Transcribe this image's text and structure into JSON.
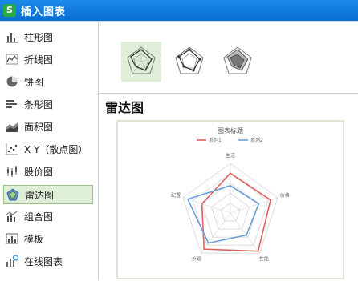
{
  "window": {
    "title": "插入图表",
    "app_icon": "S"
  },
  "sidebar": {
    "items": [
      {
        "label": "柱形图",
        "icon": "column-chart-icon"
      },
      {
        "label": "折线图",
        "icon": "line-chart-icon"
      },
      {
        "label": "饼图",
        "icon": "pie-chart-icon"
      },
      {
        "label": "条形图",
        "icon": "bar-chart-icon"
      },
      {
        "label": "面积图",
        "icon": "area-chart-icon"
      },
      {
        "label": "X Y（散点图）",
        "icon": "scatter-chart-icon"
      },
      {
        "label": "股价图",
        "icon": "stock-chart-icon"
      },
      {
        "label": "雷达图",
        "icon": "radar-chart-icon"
      },
      {
        "label": "组合图",
        "icon": "combo-chart-icon"
      },
      {
        "label": "模板",
        "icon": "template-icon"
      },
      {
        "label": "在线图表",
        "icon": "online-chart-icon"
      }
    ],
    "selected": "雷达图"
  },
  "main": {
    "section_title": "雷达图"
  },
  "chart_data": {
    "type": "radar",
    "title": "图表标题",
    "categories": [
      "生活",
      "价格",
      "性能",
      "外观",
      "配置"
    ],
    "series": [
      {
        "name": "系列1",
        "color": "#e06060",
        "values": [
          80,
          85,
          95,
          90,
          60
        ]
      },
      {
        "name": "系列2",
        "color": "#6a9fd8",
        "values": [
          55,
          60,
          55,
          75,
          90
        ]
      }
    ],
    "ylim": [
      0,
      100
    ],
    "grid": true,
    "legend": "top"
  },
  "colors": {
    "titlebar": "#0b6ed0",
    "selected_bg": "#dfeed7",
    "selected_border": "#9cc48a"
  }
}
